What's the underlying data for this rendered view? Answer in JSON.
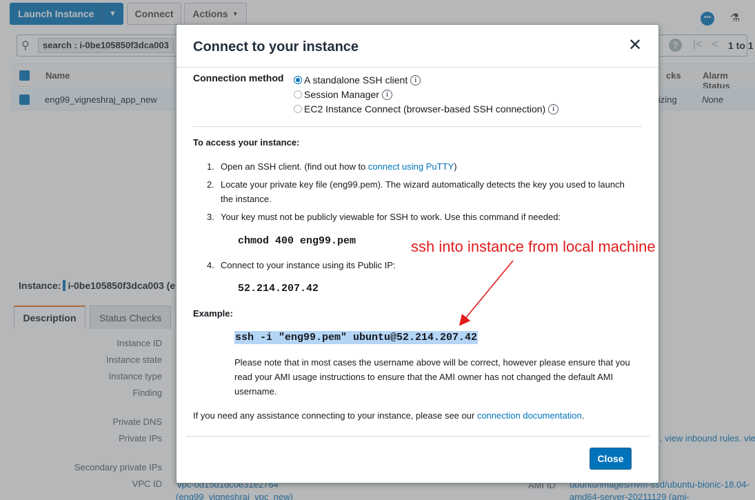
{
  "toolbar": {
    "launch_label": "Launch Instance",
    "connect_label": "Connect",
    "actions_label": "Actions"
  },
  "search": {
    "chip": "search : i-0be105850f3dca003"
  },
  "pagination": {
    "text": "1 to 1"
  },
  "table": {
    "headers": {
      "name": "Name",
      "checks": "cks",
      "alarm": "Alarm Status"
    },
    "row": {
      "name": "eng99_vigneshraj_app_new",
      "checks": "izing",
      "alarm": "None"
    }
  },
  "details": {
    "instance_prefix": "Instance:",
    "instance_id": "i-0be105850f3dca003 (e",
    "tabs": [
      "Description",
      "Status Checks"
    ],
    "labels": [
      "Instance ID",
      "Instance state",
      "Instance type",
      "Finding",
      "Private DNS",
      "Private IPs",
      "Secondary private IPs",
      "VPC ID"
    ],
    "inbound_link": ". view inbound rules. vie",
    "vpc_link": "vpc-0d15d1dc0e31e2764",
    "vpc_link2": "(eng99_vigneshraj_vpc_new)",
    "ami_label": "AMI ID",
    "ami_link": "ubuntu/images/hvm-ssd/ubuntu-bionic-18.04-",
    "ami_link2": "amd64-server-20211129 (ami-"
  },
  "modal": {
    "title": "Connect to your instance",
    "connection_method_label": "Connection method",
    "methods": [
      {
        "label": "A standalone SSH client",
        "checked": true
      },
      {
        "label": "Session Manager",
        "checked": false
      },
      {
        "label": "EC2 Instance Connect (browser-based SSH connection)",
        "checked": false
      }
    ],
    "access_title": "To access your instance:",
    "step1_num": "1.",
    "step1_text": "Open an SSH client. (find out how to ",
    "step1_link": "connect using PuTTY",
    "step1_end": ")",
    "step2_num": "2.",
    "step2_text": "Locate your private key file (eng99.pem). The wizard automatically detects the key you used to launch the instance.",
    "step3_num": "3.",
    "step3_text": "Your key must not be publicly viewable for SSH to work. Use this command if needed:",
    "chmod_cmd": "chmod 400 eng99.pem",
    "step4_num": "4.",
    "step4_text": "Connect to your instance using its Public IP:",
    "public_ip": "52.214.207.42",
    "example_title": "Example:",
    "example_cmd": "ssh -i \"eng99.pem\" ubuntu@52.214.207.42",
    "note": "Please note that in most cases the username above will be correct, however please ensure that you read your AMI usage instructions to ensure that the AMI owner has not changed the default AMI username.",
    "help_text": "If you need any assistance connecting to your instance, please see our ",
    "help_link": "connection documentation",
    "help_end": ".",
    "close_label": "Close"
  },
  "annotation": {
    "text": "ssh into instance from local machine",
    "color": "#e21b1b"
  },
  "colors": {
    "accent": "#0073bb",
    "selection": "#b4d5f5"
  }
}
